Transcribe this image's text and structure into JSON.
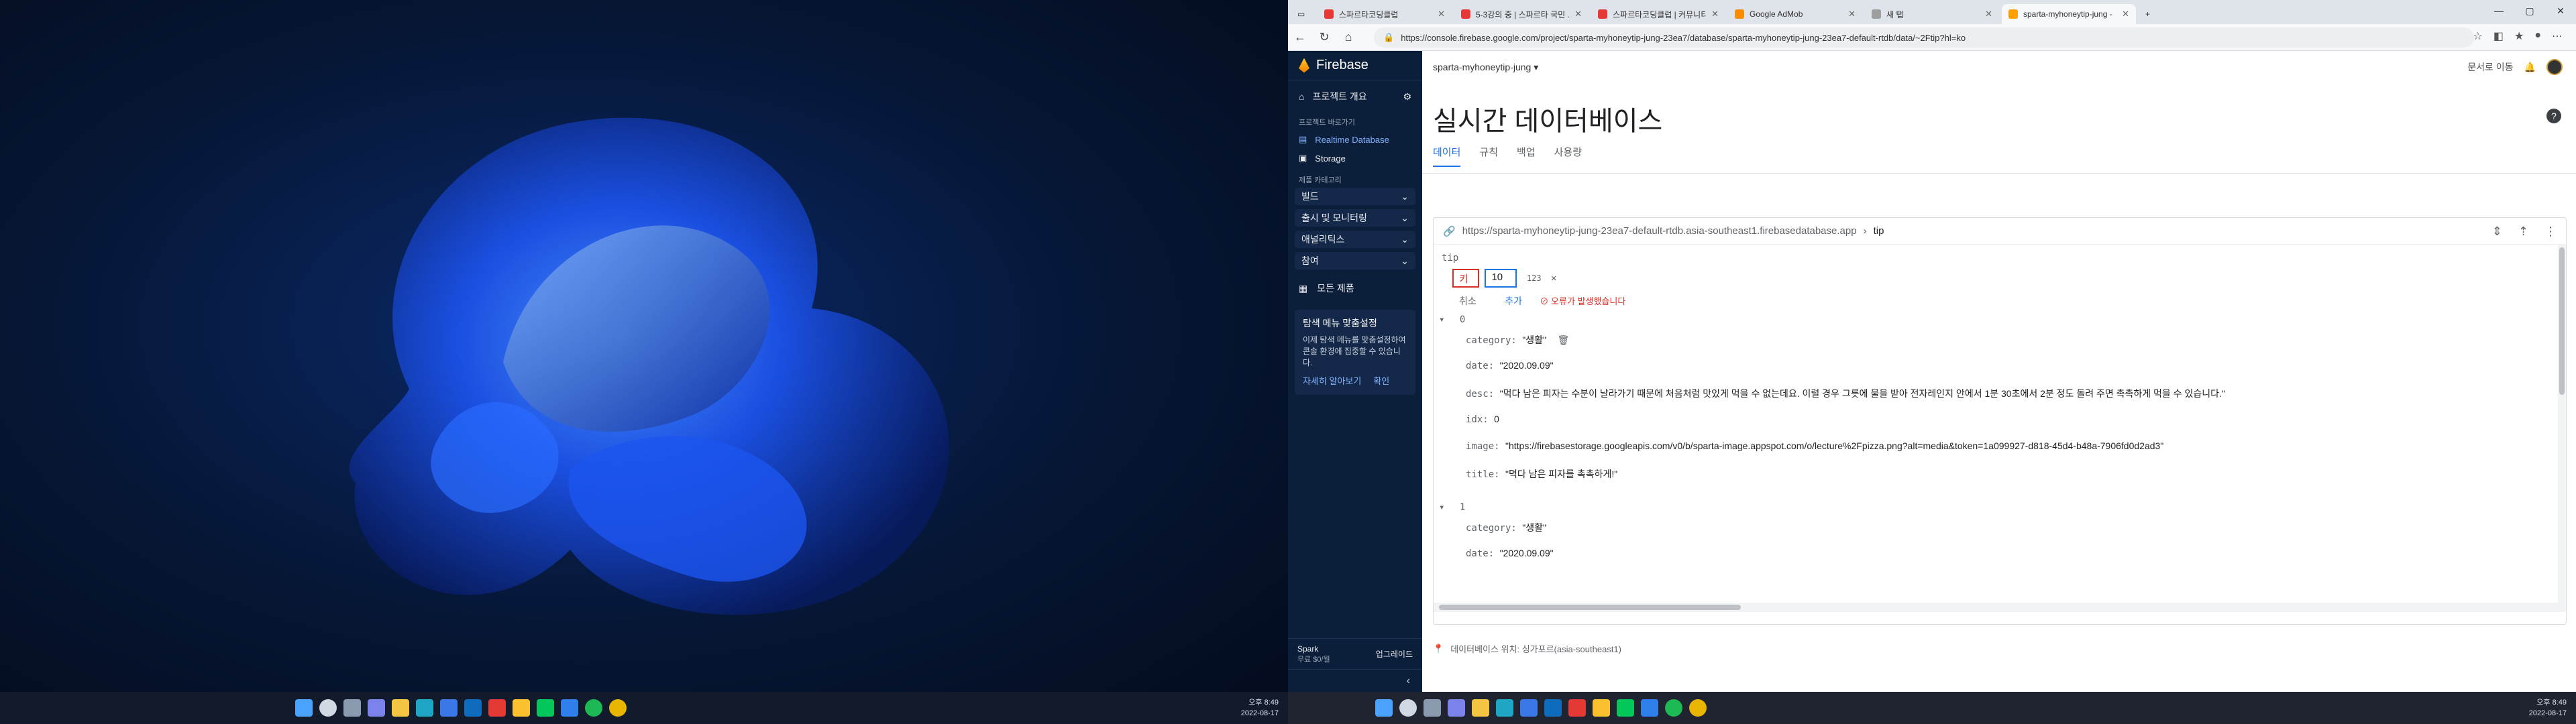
{
  "left_desktop": {
    "tray_time": "오후 8:49",
    "tray_date": "2022-08-17"
  },
  "browser": {
    "tabs": [
      {
        "title": "스파르타코딩클럽",
        "color": "#e53935"
      },
      {
        "title": "5-3강의 중 | 스파르타 국민 ...",
        "color": "#e53935"
      },
      {
        "title": "스파르타코딩클럽 | 커뮤니티 ...",
        "color": "#e53935"
      },
      {
        "title": "Google AdMob",
        "color": "#fb8c00"
      },
      {
        "title": "새 탭",
        "color": "#9e9e9e"
      },
      {
        "title": "sparta-myhoneytip-jung -",
        "color": "#ffa000"
      }
    ],
    "url": "https://console.firebase.google.com/project/sparta-myhoneytip-jung-23ea7/database/sparta-myhoneytip-jung-23ea7-default-rtdb/data/~2Ftip?hl=ko"
  },
  "firebase": {
    "brand": "Firebase",
    "overview": "프로젝트 개요",
    "shortcuts_caption": "프로젝트 바로가기",
    "shortcut_rtdb": "Realtime Database",
    "shortcut_storage": "Storage",
    "category_caption": "제품 카테고리",
    "groups": [
      "빌드",
      "출시 및 모니터링",
      "애널리틱스",
      "참여"
    ],
    "all_products": "모든 제품",
    "card_title": "탐색 메뉴 맞춤설정",
    "card_body": "이제 탐색 메뉴를 맞춤설정하여 콘솔 환경에 집중할 수 있습니다.",
    "card_learn": "자세히 알아보기",
    "card_ok": "확인",
    "plan_name": "Spark",
    "plan_desc": "무료 $0/월",
    "upgrade": "업그레이드",
    "project": "sparta-myhoneytip-jung",
    "goto_docs": "문서로 이동",
    "page_title": "실시간 데이터베이스",
    "tabs": [
      "데이터",
      "규칙",
      "백업",
      "사용량"
    ],
    "ref_url": "https://sparta-myhoneytip-jung-23ea7-default-rtdb.asia-southeast1.firebasedatabase.app",
    "ref_node": "tip",
    "root_key": "tip",
    "new_key_placeholder": "키",
    "new_value": "10",
    "type_label": "123",
    "cancel": "취소",
    "add": "추가",
    "error": "오류가 발생했습니다",
    "item0_key": "0",
    "item0": [
      {
        "k": "category:",
        "v": "\"생활\""
      },
      {
        "k": "date:",
        "v": "\"2020.09.09\""
      },
      {
        "k": "desc:",
        "v": "\"먹다 남은 피자는 수분이 날라가기 때문에 처음처럼 맛있게 먹을 수 없는데요. 이럴 경우 그릇에 물을 받아 전자레인지 안에서 1분 30초에서 2분 정도 돌려 주면 촉촉하게 먹을 수 있습니다.\""
      },
      {
        "k": "idx:",
        "v": "0"
      },
      {
        "k": "image:",
        "v": "\"https://firebasestorage.googleapis.com/v0/b/sparta-image.appspot.com/o/lecture%2Fpizza.png?alt=media&token=1a099927-d818-45d4-b48a-7906fd0d2ad3\""
      },
      {
        "k": "title:",
        "v": "\"먹다 남은 피자를 촉촉하게!\""
      }
    ],
    "item1_key": "1",
    "item1": [
      {
        "k": "category:",
        "v": "\"생활\""
      },
      {
        "k": "date:",
        "v": "\"2020.09.09\""
      }
    ],
    "location": "데이터베이스 위치: 싱가포르(asia-southeast1)"
  },
  "right_tray_time": "오후 8:49",
  "right_tray_date": "2022-08-17"
}
